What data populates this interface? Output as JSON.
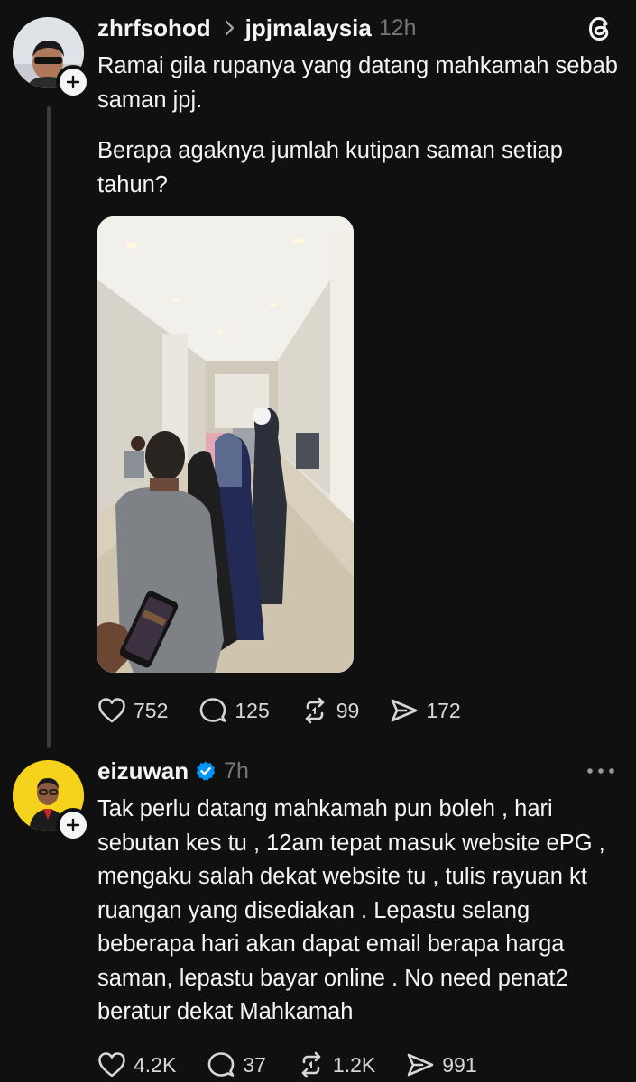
{
  "post1": {
    "username": "zhrfsohod",
    "replying_to": "jpjmalaysia",
    "time": "12h",
    "paragraph1": "Ramai gila rupanya yang datang mahkamah sebab saman jpj.",
    "paragraph2": "Berapa agaknya jumlah kutipan saman setiap tahun?",
    "likes": "752",
    "comments": "125",
    "reposts": "99",
    "shares": "172"
  },
  "post2": {
    "username": "eizuwan",
    "verified": true,
    "time": "7h",
    "text": "Tak perlu datang mahkamah pun boleh , hari sebutan kes tu , 12am tepat masuk website ePG , mengaku salah dekat website tu , tulis rayuan kt ruangan yang disediakan . Lepastu selang beberapa hari akan dapat email berapa harga saman, lepastu bayar online . No need penat2 beratur dekat Mahkamah",
    "likes": "4.2K",
    "comments": "37",
    "reposts": "1.2K",
    "shares": "991"
  },
  "icons": {
    "app_logo": "threads-logo-icon",
    "chevron": "chevron-right-icon",
    "more": "more-dots-icon",
    "verified": "verified-badge-icon",
    "like": "heart-icon",
    "comment": "comment-bubble-icon",
    "repost": "repost-icon",
    "share": "share-send-icon",
    "follow": "plus-icon"
  },
  "colors": {
    "background": "#101010",
    "text": "#f3f5f7",
    "muted": "#777777",
    "verified": "#0095f6",
    "thread_line": "#3a3a3a"
  }
}
